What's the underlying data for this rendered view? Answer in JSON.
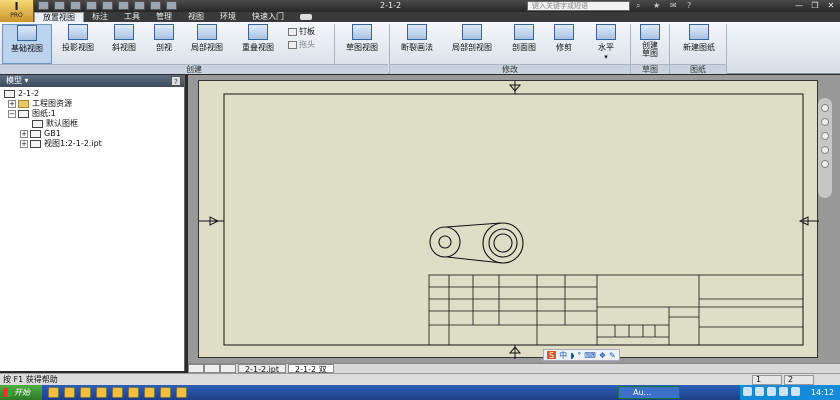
{
  "app": {
    "logo_text": "PRO",
    "title": "2-1-2"
  },
  "search": {
    "placeholder": "键入关键字或短语"
  },
  "tabs": [
    {
      "label": "放置视图",
      "active": true
    },
    {
      "label": "标注"
    },
    {
      "label": "工具"
    },
    {
      "label": "管理"
    },
    {
      "label": "视图"
    },
    {
      "label": "环境"
    },
    {
      "label": "快速入门"
    }
  ],
  "ribbon": {
    "create": {
      "group_label": "创建",
      "base_view": "基础视图",
      "projected_view": "投影视图",
      "auxiliary_view": "斜视图",
      "section_view": "剖视",
      "detail_view": "局部视图",
      "overlay_view": "重叠视图",
      "nailboard": "钉板",
      "draft": "草图视图"
    },
    "break_out": "拖头",
    "modify": {
      "group_label": "修改",
      "break": "断裂画法",
      "breakout": "局部剖视图",
      "slice": "剖面图",
      "crop": "修剪",
      "horizontal": "水平"
    },
    "sketch": {
      "group_label": "草图",
      "create_sketch": "创建\n草图"
    },
    "sheet": {
      "group_label": "图纸",
      "new_sheet": "新建图纸"
    }
  },
  "panel": {
    "title": "模型 ▾",
    "help": "?",
    "tree": [
      {
        "label": "2-1-2"
      },
      {
        "label": "工程图资源"
      },
      {
        "label": "图纸:1"
      },
      {
        "label": "默认图框"
      },
      {
        "label": "GB1"
      },
      {
        "label": "视图1:2-1-2.ipt"
      }
    ]
  },
  "sheet_tabs": [
    {
      "label": "2-1-2.ipt"
    },
    {
      "label": "2-1-2 双",
      "active": true
    }
  ],
  "ime": {
    "mode": "中",
    "logo": "S"
  },
  "status": {
    "text": "按 F1 获得帮助",
    "cell1": "1",
    "cell2": "2"
  },
  "taskbar": {
    "start": "开始",
    "task": "Au...",
    "clock": "14:12"
  },
  "colors": {
    "paper": "#dedec7",
    "canvas": "#999999",
    "ribbon_accent": "#35659c"
  }
}
